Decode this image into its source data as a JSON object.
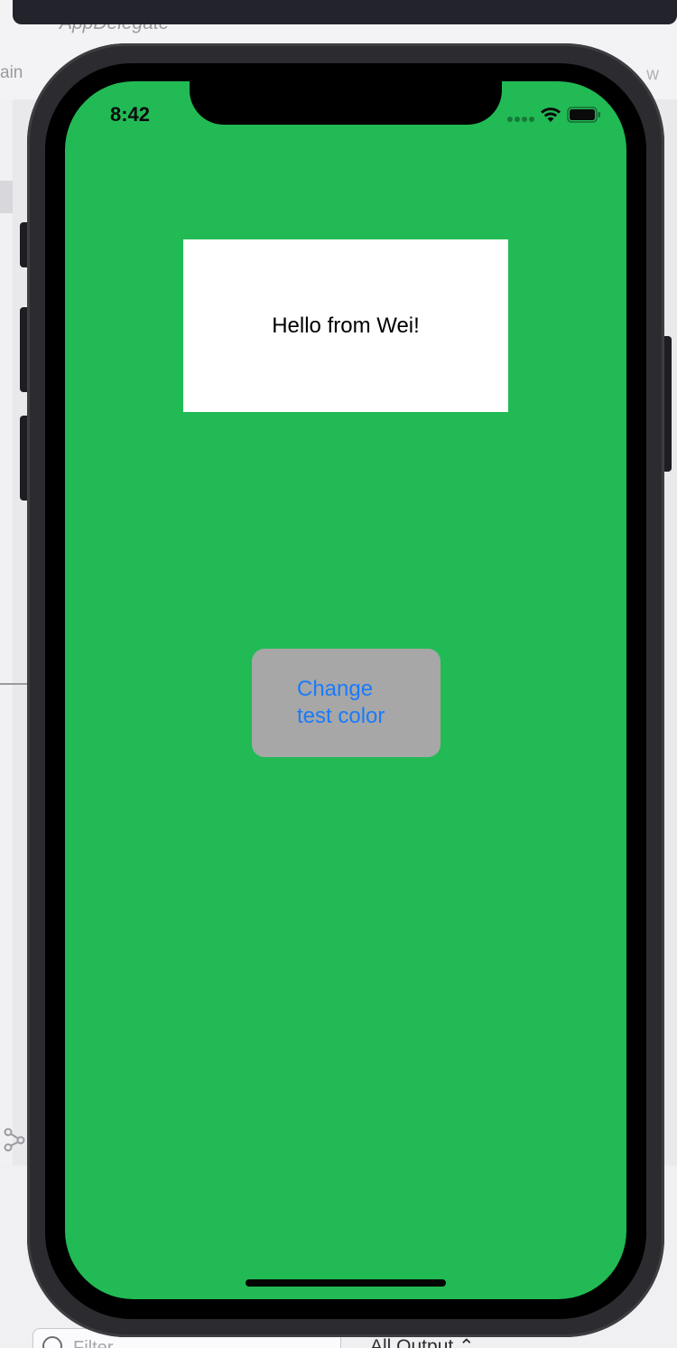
{
  "xcode": {
    "tab_title": "AppDelegate",
    "breadcrumb_start": "ain",
    "breadcrumb_end": "w",
    "filter_placeholder": "Filter",
    "output_selector": "All Output ⌃"
  },
  "simulator": {
    "status_time": "8:42",
    "background_color": "#22ba55"
  },
  "main": {
    "label_text": "Hello from Wei!",
    "label_bg": "#ffffff",
    "button_line1": "Change",
    "button_line2": "test color",
    "button_bg": "#a7a7a7",
    "button_text_color": "#1a7bfb"
  },
  "icons": {
    "wifi": "wifi-icon",
    "battery": "battery-icon",
    "signal": "signal-dots-icon",
    "filter": "filter-icon",
    "share": "share-icon"
  }
}
